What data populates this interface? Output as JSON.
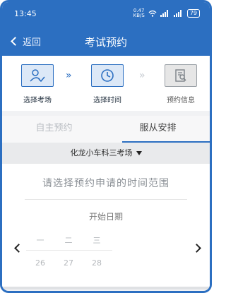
{
  "status_bar": {
    "time": "13:45",
    "net_speed": "0.47",
    "net_unit": "KB/S",
    "signal1": "4G",
    "signal2": "HD",
    "battery": "79"
  },
  "header": {
    "back_label": "返回",
    "title": "考试预约"
  },
  "steps": [
    {
      "label": "选择考场",
      "icon": "checkmark-person-icon",
      "state": "done"
    },
    {
      "label": "选择时间",
      "icon": "clock-icon",
      "state": "active"
    },
    {
      "label": "预约信息",
      "icon": "document-search-icon",
      "state": "inactive"
    }
  ],
  "tabs": [
    {
      "label": "自主预约",
      "selected": false
    },
    {
      "label": "服从安排",
      "selected": true
    }
  ],
  "venue": {
    "selected": "化龙小车科三考场"
  },
  "main": {
    "hint": "请选择预约申请的时间范围",
    "start_label": "开始日期"
  },
  "calendar": {
    "weekdays": [
      "一",
      "二",
      "三"
    ],
    "days": [
      "26",
      "27",
      "28"
    ]
  },
  "colors": {
    "accent": "#2c6fc1",
    "step_active_bg": "#dce8f7"
  }
}
